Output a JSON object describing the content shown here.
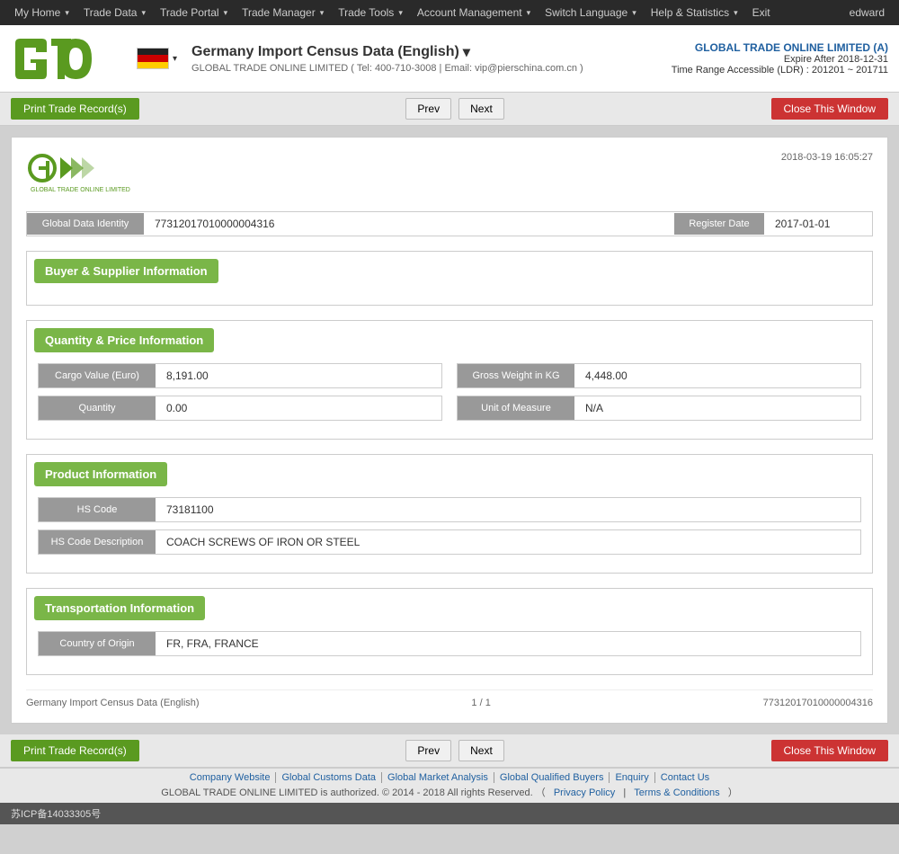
{
  "topnav": {
    "items": [
      {
        "label": "My Home",
        "id": "my-home"
      },
      {
        "label": "Trade Data",
        "id": "trade-data"
      },
      {
        "label": "Trade Portal",
        "id": "trade-portal"
      },
      {
        "label": "Trade Manager",
        "id": "trade-manager"
      },
      {
        "label": "Trade Tools",
        "id": "trade-tools"
      },
      {
        "label": "Account Management",
        "id": "account-management"
      },
      {
        "label": "Switch Language",
        "id": "switch-language"
      },
      {
        "label": "Help & Statistics",
        "id": "help-statistics"
      },
      {
        "label": "Exit",
        "id": "exit"
      }
    ],
    "user": "edward"
  },
  "header": {
    "title": "Germany Import Census Data (English)",
    "subtitle": "GLOBAL TRADE ONLINE LIMITED ( Tel: 400-710-3008  |  Email: vip@pierschina.com.cn )",
    "company": "GLOBAL TRADE ONLINE LIMITED (A)",
    "expire": "Expire After 2018-12-31",
    "time_range": "Time Range Accessible (LDR) : 201201 ~ 201711"
  },
  "toolbar": {
    "print_label": "Print Trade Record(s)",
    "prev_label": "Prev",
    "next_label": "Next",
    "close_label": "Close This Window"
  },
  "record": {
    "timestamp": "2018-03-19 16:05:27",
    "global_data_identity_label": "Global Data Identity",
    "global_data_identity_value": "77312017010000004316",
    "register_date_label": "Register Date",
    "register_date_value": "2017-01-01",
    "buyer_supplier_section": "Buyer & Supplier Information",
    "quantity_section": "Quantity & Price Information",
    "cargo_value_label": "Cargo Value (Euro)",
    "cargo_value": "8,191.00",
    "gross_weight_label": "Gross Weight in KG",
    "gross_weight": "4,448.00",
    "quantity_label": "Quantity",
    "quantity_value": "0.00",
    "unit_of_measure_label": "Unit of Measure",
    "unit_of_measure_value": "N/A",
    "product_section": "Product Information",
    "hs_code_label": "HS Code",
    "hs_code_value": "73181100",
    "hs_code_desc_label": "HS Code Description",
    "hs_code_desc_value": "COACH SCREWS OF IRON OR STEEL",
    "transport_section": "Transportation Information",
    "country_origin_label": "Country of Origin",
    "country_origin_value": "FR, FRA, FRANCE",
    "footer_title": "Germany Import Census Data (English)",
    "footer_page": "1 / 1",
    "footer_id": "77312017010000004316"
  },
  "footer": {
    "links": [
      "Company Website",
      "Global Customs Data",
      "Global Market Analysis",
      "Global Qualified Buyers",
      "Enquiry",
      "Contact Us"
    ],
    "copyright": "GLOBAL TRADE ONLINE LIMITED is authorized. © 2014 - 2018 All rights Reserved.  （",
    "privacy": "Privacy Policy",
    "separator": " | ",
    "terms": "Terms & Conditions",
    "close_paren": " ）"
  },
  "icp": {
    "text": "苏ICP备14033305号"
  }
}
